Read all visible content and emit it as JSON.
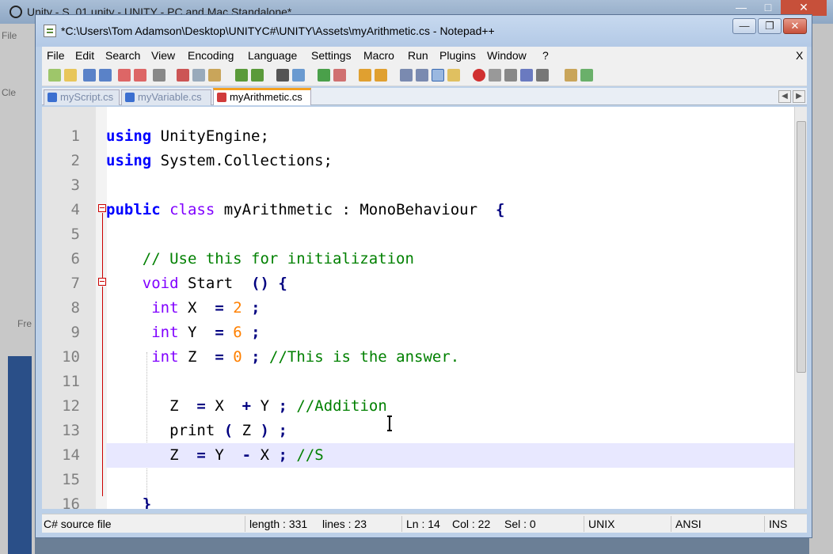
{
  "background_window": {
    "title": "Unity - S_01.unity - UNITY - PC and Mac Standalone*",
    "left_labels": [
      "File",
      "Cle",
      "Fre"
    ]
  },
  "npp": {
    "title": "*C:\\Users\\Tom Adamson\\Desktop\\UNITYC#\\UNITY\\Assets\\myArithmetic.cs - Notepad++",
    "menu": [
      "File",
      "Edit",
      "Search",
      "View",
      "Encoding",
      "Language",
      "Settings",
      "Macro",
      "Run",
      "Plugins",
      "Window",
      "?"
    ],
    "menu_close": "X",
    "tabs": [
      {
        "label": "myScript.cs",
        "active": false
      },
      {
        "label": "myVariable.cs",
        "active": false
      },
      {
        "label": "myArithmetic.cs",
        "active": true
      }
    ],
    "lines": [
      {
        "n": "1",
        "tokens": [
          [
            "kw",
            "using"
          ],
          [
            "",
            "UnityEngine;"
          ]
        ]
      },
      {
        "n": "2",
        "tokens": [
          [
            "kw",
            "using"
          ],
          [
            "",
            "System.Collections;"
          ]
        ]
      },
      {
        "n": "3",
        "tokens": []
      },
      {
        "n": "4",
        "tokens": [
          [
            "kw",
            "public"
          ],
          [
            "kw2",
            "class"
          ],
          [
            "",
            "myArithmetic : MonoBehaviour "
          ],
          [
            "op",
            "{"
          ]
        ]
      },
      {
        "n": "5",
        "tokens": []
      },
      {
        "n": "6",
        "tokens": [
          [
            "cm",
            "    // Use this for initialization"
          ]
        ]
      },
      {
        "n": "7",
        "tokens": [
          [
            "kw2",
            "    void"
          ],
          [
            "",
            "Start "
          ],
          [
            "op",
            "()"
          ],
          [
            "op",
            "{"
          ]
        ]
      },
      {
        "n": "8",
        "tokens": [
          [
            "ty",
            "     int"
          ],
          [
            "",
            "X "
          ],
          [
            "op",
            "="
          ],
          [
            "num",
            "2"
          ],
          [
            "op",
            ";"
          ]
        ]
      },
      {
        "n": "9",
        "tokens": [
          [
            "ty",
            "     int"
          ],
          [
            "",
            "Y "
          ],
          [
            "op",
            "="
          ],
          [
            "num",
            "6"
          ],
          [
            "op",
            ";"
          ]
        ]
      },
      {
        "n": "10",
        "tokens": [
          [
            "ty",
            "     int"
          ],
          [
            "",
            "Z "
          ],
          [
            "op",
            "="
          ],
          [
            "num",
            "0"
          ],
          [
            "op",
            ";"
          ],
          [
            "cm",
            "//This is the answer."
          ]
        ]
      },
      {
        "n": "11",
        "tokens": []
      },
      {
        "n": "12",
        "tokens": [
          [
            "",
            "       Z "
          ],
          [
            "op",
            "="
          ],
          [
            "",
            "X "
          ],
          [
            "op",
            "+"
          ],
          [
            "",
            "Y"
          ],
          [
            "op",
            ";"
          ],
          [
            "cm",
            "//Addition"
          ]
        ]
      },
      {
        "n": "13",
        "tokens": [
          [
            "",
            "       print"
          ],
          [
            "op",
            "("
          ],
          [
            "",
            "Z"
          ],
          [
            "op",
            ")"
          ],
          [
            "op",
            ";"
          ]
        ]
      },
      {
        "n": "14",
        "tokens": [
          [
            "",
            "       Z "
          ],
          [
            "op",
            "="
          ],
          [
            "",
            "Y "
          ],
          [
            "op",
            "-"
          ],
          [
            "",
            "X"
          ],
          [
            "op",
            ";"
          ],
          [
            "cm",
            "//S"
          ]
        ]
      },
      {
        "n": "15",
        "tokens": []
      },
      {
        "n": "16",
        "tokens": [
          [
            "op",
            "    }"
          ]
        ]
      }
    ],
    "highlight_line": "14",
    "status": {
      "type": "C# source file",
      "length": "length : 331",
      "lines": "lines : 23",
      "ln": "Ln : 14",
      "col": "Col : 22",
      "sel": "Sel : 0",
      "eol": "UNIX",
      "encoding": "ANSI",
      "mode": "INS"
    },
    "colors": {
      "keyword": "#0000ff",
      "type": "#8000ff",
      "comment": "#008000",
      "number": "#ff8000",
      "highlight": "#e8e8ff"
    }
  }
}
